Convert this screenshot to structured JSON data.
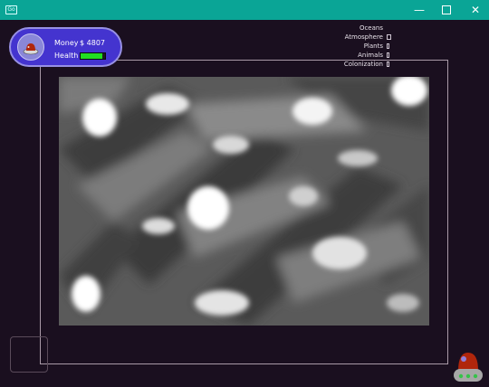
{
  "window": {
    "app_icon_label": "Go",
    "minimize_glyph": "—",
    "close_glyph": "✕"
  },
  "hud": {
    "money_label": "Money",
    "money_value": "$ 4807",
    "health_label": "Health",
    "health_fraction": 0.9
  },
  "status": {
    "items": [
      {
        "label": "Oceans"
      },
      {
        "label": "Atmosphere"
      },
      {
        "label": "Plants"
      },
      {
        "label": "Animals"
      },
      {
        "label": "Colonization"
      }
    ]
  },
  "colors": {
    "titlebar": "#0aa596",
    "background": "#1a0f1f",
    "hud_panel": "#4434cf",
    "health": "#22dd22",
    "ufo_dome": "#b0260c",
    "ufo_body": "#a7a7a7",
    "ufo_lights": "#36c24a"
  },
  "icons": {
    "portrait": "ufo-pilot-icon",
    "player": "ufo-icon"
  }
}
